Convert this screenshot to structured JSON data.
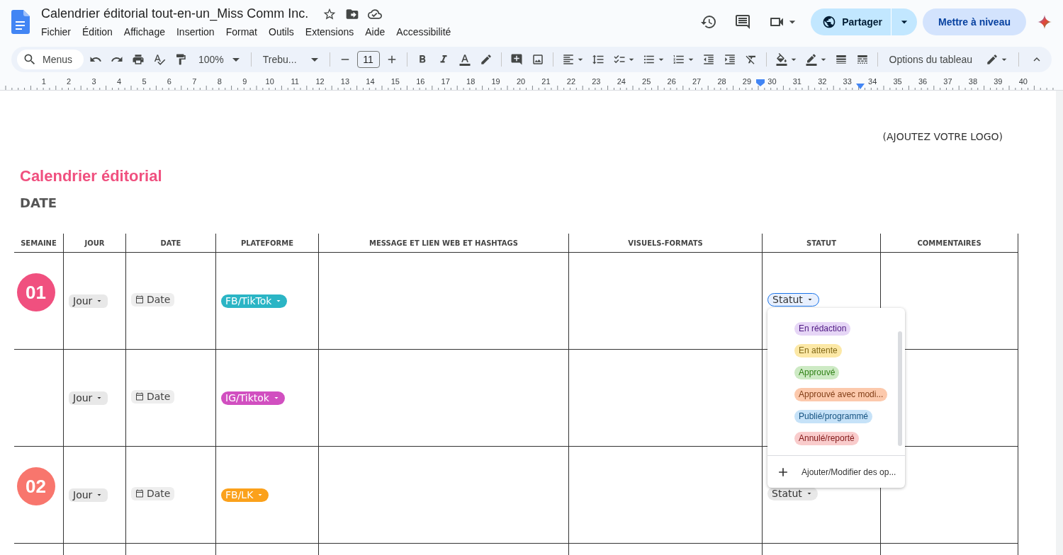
{
  "document": {
    "title": "Calendrier éditorial tout-en-un_Miss Comm Inc."
  },
  "menu_bar": [
    "Fichier",
    "Édition",
    "Affichage",
    "Insertion",
    "Format",
    "Outils",
    "Extensions",
    "Aide",
    "Accessibilité"
  ],
  "header_buttons": {
    "share": "Partager",
    "upgrade": "Mettre à niveau"
  },
  "toolbar": {
    "search": {
      "placeholder": "Menus"
    },
    "zoom": "100%",
    "font": "Trebu...",
    "font_size": "11",
    "table_options": "Options du tableau"
  },
  "ruler": [
    "1",
    "2",
    "3",
    "4",
    "5",
    "6",
    "7",
    "8",
    "9",
    "10",
    "11",
    "12",
    "13",
    "14",
    "15",
    "16",
    "17",
    "18",
    "19",
    "20",
    "21",
    "22",
    "23",
    "24",
    "25",
    "26",
    "27",
    "28",
    "29",
    "30",
    "31",
    "32",
    "33",
    "34",
    "35",
    "36",
    "37",
    "38",
    "39",
    "40"
  ],
  "page": {
    "logo_note": "(AJOUTEZ VOTRE LOGO)",
    "heading": "Calendrier éditorial",
    "subheading": "DATE"
  },
  "table": {
    "columns": [
      "SEMAINE",
      "JOUR",
      "DATE",
      "PLATEFORME",
      "MESSAGE ET LIEN WEB ET HASHTAGS",
      "VISUELS-FORMATS",
      "STATUT",
      "COMMENTAIRES"
    ],
    "rows": [
      {
        "week": {
          "text": "01",
          "color": "#f0507f"
        },
        "day": "Jour",
        "date": "Date",
        "platform": {
          "text": "FB/TikTok",
          "color": "#2bb5c5"
        },
        "status": {
          "text": "Statut",
          "focused": true
        }
      },
      {
        "day": "Jour",
        "date": "Date",
        "platform": {
          "text": "IG/Tiktok",
          "color": "#d14fc0"
        }
      },
      {
        "week": {
          "text": "02",
          "color": "#f8766d"
        },
        "day": "Jour",
        "date": "Date",
        "platform": {
          "text": "FB/LK",
          "color": "#fba11b"
        },
        "status": {
          "text": "Statut",
          "focused": false
        }
      }
    ]
  },
  "status_menu": {
    "options": [
      {
        "label": "En rédaction",
        "color": "#e6d6f6"
      },
      {
        "label": "En attente",
        "color": "#fce8a6"
      },
      {
        "label": "Approuvé",
        "color": "#cdeac4"
      },
      {
        "label": "Approuvé avec modi...",
        "color": "#fcc9ac"
      },
      {
        "label": "Publié/programmé",
        "color": "#c6e2f8"
      },
      {
        "label": "Annulé/reporté",
        "color": "#f9cccc"
      }
    ],
    "footer": "Ajouter/Modifier des op..."
  }
}
